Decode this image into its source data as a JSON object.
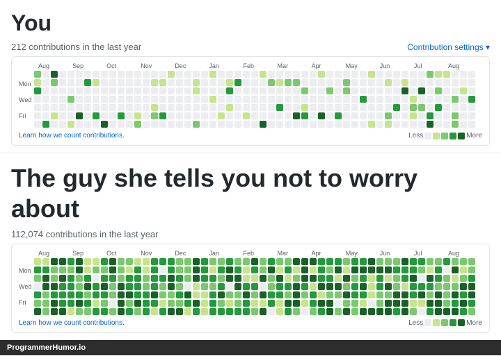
{
  "section1": {
    "title": "You",
    "contributions_text": "212 contributions in the last year",
    "settings_label": "Contribution settings ▾",
    "learn_link": "Learn how we count contributions.",
    "legend_less": "Less",
    "legend_more": "More"
  },
  "section2": {
    "title": "The guy she tells you not to worry about",
    "contributions_text": "112,074 contributions in the last year",
    "learn_link": "Learn how we count contributions.",
    "legend_less": "Less",
    "legend_more": "More"
  },
  "months": [
    "Aug",
    "Sep",
    "Oct",
    "Nov",
    "Dec",
    "Jan",
    "Feb",
    "Mar",
    "Apr",
    "May",
    "Jun",
    "Jul",
    "Aug"
  ],
  "days": [
    "Mon",
    "",
    "Wed",
    "",
    "Fri"
  ],
  "watermark": "ProgrammerHumor.io"
}
